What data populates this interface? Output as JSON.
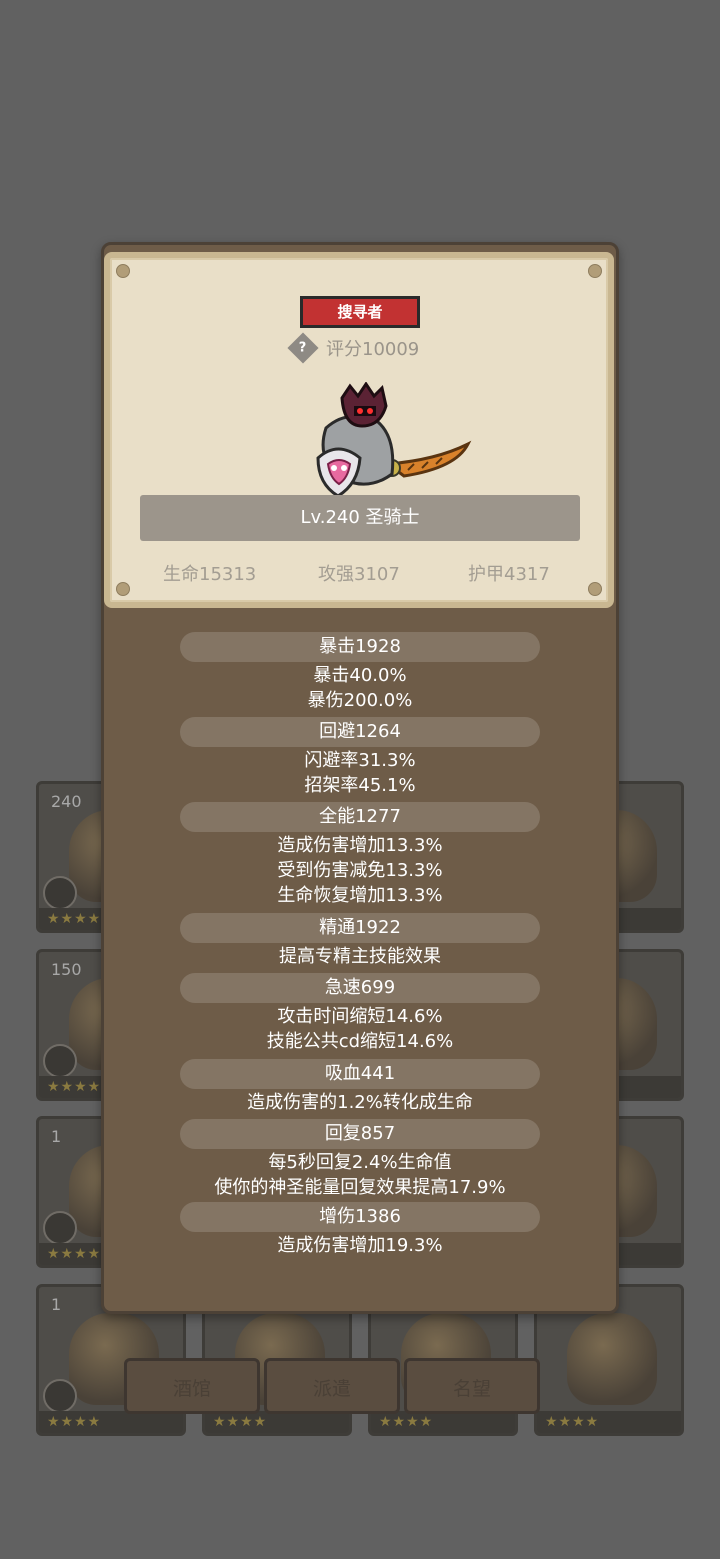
{
  "hero": {
    "title_badge": "搜寻者",
    "score_icon": "?",
    "score": "评分10009",
    "name": "Lv.240 圣骑士",
    "hp": "生命15313",
    "atk": "攻强3107",
    "armor": "护甲4317"
  },
  "attributes": [
    {
      "header": "暴击1928",
      "lines": [
        "暴击40.0%",
        "暴伤200.0%"
      ]
    },
    {
      "header": "回避1264",
      "lines": [
        "闪避率31.3%",
        "招架率45.1%"
      ]
    },
    {
      "header": "全能1277",
      "lines": [
        "造成伤害增加13.3%",
        "受到伤害减免13.3%",
        "生命恢复增加13.3%"
      ]
    },
    {
      "header": "精通1922",
      "lines": [
        "提高专精主技能效果"
      ]
    },
    {
      "header": "急速699",
      "lines": [
        "攻击时间缩短14.6%",
        "技能公共cd缩短14.6%"
      ]
    },
    {
      "header": "吸血441",
      "lines": [
        "造成伤害的1.2%转化成生命"
      ]
    },
    {
      "header": "回复857",
      "lines": [
        "每5秒回复2.4%生命值",
        "使你的神圣能量回复效果提高17.9%"
      ]
    },
    {
      "header": "增伤1386",
      "lines": [
        "造成伤害增加19.3%"
      ]
    }
  ],
  "background": {
    "levels": [
      "240",
      "150",
      "1",
      "1"
    ],
    "tabs": [
      "酒馆",
      "派遣",
      "名望"
    ],
    "star_glyphs": "★★★★"
  },
  "colors": {
    "overlay": "#616161",
    "panel": "#6e5c48",
    "parchment": "#e9dfc8",
    "badge_red": "#c23232",
    "attr_header": "#847564"
  }
}
